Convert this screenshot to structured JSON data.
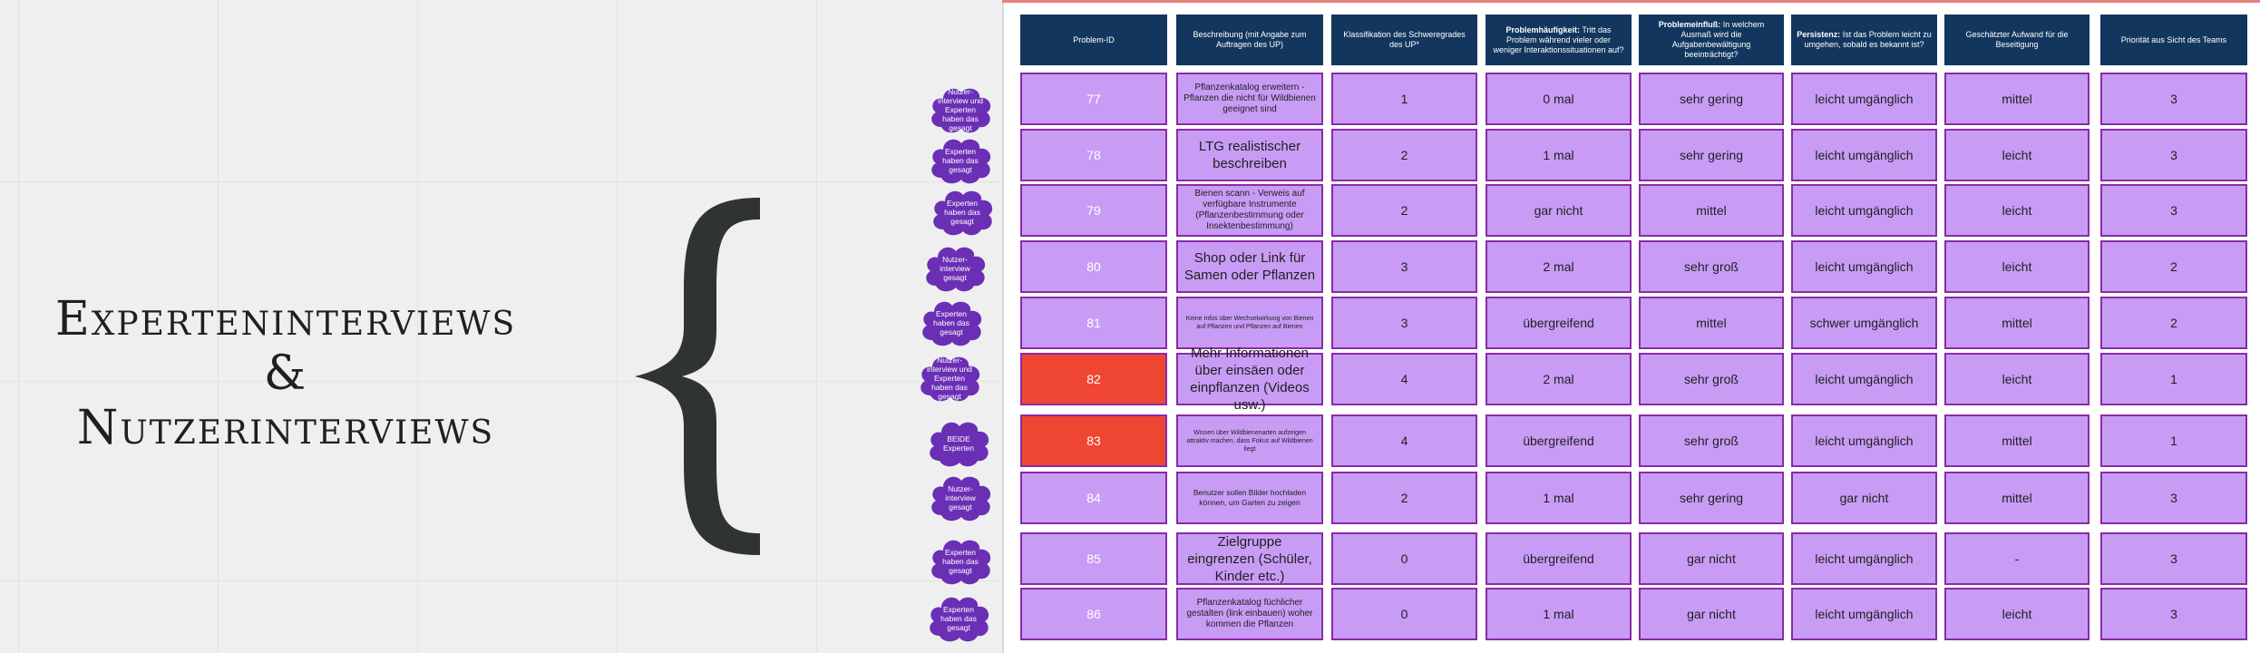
{
  "title_lines": [
    "Experteninterviews",
    "&",
    "Nutzerinterviews"
  ],
  "headers": [
    {
      "bold": "",
      "text": "Problem-ID"
    },
    {
      "bold": "",
      "text": "Beschreibung (mit Angabe zum Auftragen des UP)"
    },
    {
      "bold": "",
      "text": "Klassifikation des Schweregrades des UP*"
    },
    {
      "bold": "Problemhäufigkeit:",
      "text": " Tritt das Problem während vieler oder weniger Interaktionssituationen auf?"
    },
    {
      "bold": "Problemeinfluß:",
      "text": " In welchem Ausmaß wird die Aufgabenbewältigung beeinträchtigt?"
    },
    {
      "bold": "Persistenz:",
      "text": " Ist das Problem leicht zu umgehen, sobald es bekannt ist?"
    },
    {
      "bold": "",
      "text": "Geschätzter Aufwand für die Beseitigung"
    },
    {
      "bold": "",
      "text": "Priorität aus Sicht des Teams"
    }
  ],
  "rows": [
    {
      "cloud": "Nutzer-interview und Experten haben das gesagt",
      "id": "77",
      "desc": "Pflanzenkatalog erweitern -Pflanzen die nicht für Wildbienen geeignet sind",
      "desc_size": "med",
      "severity": "1",
      "frequency": "0 mal",
      "impact": "sehr gering",
      "persistence": "leicht umgänglich",
      "effort": "mittel",
      "priority": "3",
      "highlight": false
    },
    {
      "cloud": "Experten haben das gesagt",
      "id": "78",
      "desc": "LTG realistischer beschreiben",
      "desc_size": "big",
      "severity": "2",
      "frequency": "1 mal",
      "impact": "sehr gering",
      "persistence": "leicht umgänglich",
      "effort": "leicht",
      "priority": "3",
      "highlight": false
    },
    {
      "cloud": "Experten haben das gesagt",
      "id": "79",
      "desc": "Bienen scann - Verweis auf verfügbare Instrumente (Pflanzenbestimmung oder Insektenbestimmung)",
      "desc_size": "med",
      "severity": "2",
      "frequency": "gar nicht",
      "impact": "mittel",
      "persistence": "leicht umgänglich",
      "effort": "leicht",
      "priority": "3",
      "highlight": false
    },
    {
      "cloud": "Nutzer-interview gesagt",
      "id": "80",
      "desc": "Shop oder Link für Samen oder Pflanzen",
      "desc_size": "big",
      "severity": "3",
      "frequency": "2 mal",
      "impact": "sehr groß",
      "persistence": "leicht umgänglich",
      "effort": "leicht",
      "priority": "2",
      "highlight": false
    },
    {
      "cloud": "Experten haben das gesagt",
      "id": "81",
      "desc": "Keine Infos über Wechselwirkung von Bienen auf Pflanzen und Pflanzen auf Bienen",
      "desc_size": "xs",
      "severity": "3",
      "frequency": "übergreifend",
      "impact": "mittel",
      "persistence": "schwer umgänglich",
      "effort": "mittel",
      "priority": "2",
      "highlight": false
    },
    {
      "cloud": "Nutzer-interview und Experten haben das gesagt",
      "id": "82",
      "desc": "Mehr Informationen über einsäen oder einpflanzen (Videos usw.)",
      "desc_size": "big",
      "severity": "4",
      "frequency": "2 mal",
      "impact": "sehr groß",
      "persistence": "leicht umgänglich",
      "effort": "leicht",
      "priority": "1",
      "highlight": true
    },
    {
      "cloud": "BEIDE Experten",
      "id": "83",
      "desc": "Wissen über Wildbienenarten aufzeigen attraktiv machen, dass Fokus auf Wildbienen liegt",
      "desc_size": "xs",
      "severity": "4",
      "frequency": "übergreifend",
      "impact": "sehr groß",
      "persistence": "leicht umgänglich",
      "effort": "mittel",
      "priority": "1",
      "highlight": true
    },
    {
      "cloud": "Nutzer-interview gesagt",
      "id": "84",
      "desc": "Benutzer sollen Bilder hochladen können, um Garten zu zeigen",
      "desc_size": "small",
      "severity": "2",
      "frequency": "1 mal",
      "impact": "sehr gering",
      "persistence": "gar nicht",
      "effort": "mittel",
      "priority": "3",
      "highlight": false
    },
    {
      "cloud": "Experten haben das gesagt",
      "id": "85",
      "desc": "Zielgruppe eingrenzen (Schüler, Kinder etc.)",
      "desc_size": "big",
      "severity": "0",
      "frequency": "übergreifend",
      "impact": "gar nicht",
      "persistence": "leicht umgänglich",
      "effort": "-",
      "priority": "3",
      "highlight": false
    },
    {
      "cloud": "Experten haben das gesagt",
      "id": "86",
      "desc": "Pflanzenkatalog füchlicher gestalten (link einbauen) woher kommen die Pflanzen",
      "desc_size": "med",
      "severity": "0",
      "frequency": "1 mal",
      "impact": "gar nicht",
      "persistence": "leicht umgänglich",
      "effort": "leicht",
      "priority": "3",
      "highlight": false
    }
  ],
  "colors": {
    "header_bg": "#12365e",
    "cell_bg": "#c89cf5",
    "cell_border": "#8a2aa6",
    "highlight": "#ef4634",
    "cloud": "#6a2fb5",
    "brace": "#2f3332"
  }
}
